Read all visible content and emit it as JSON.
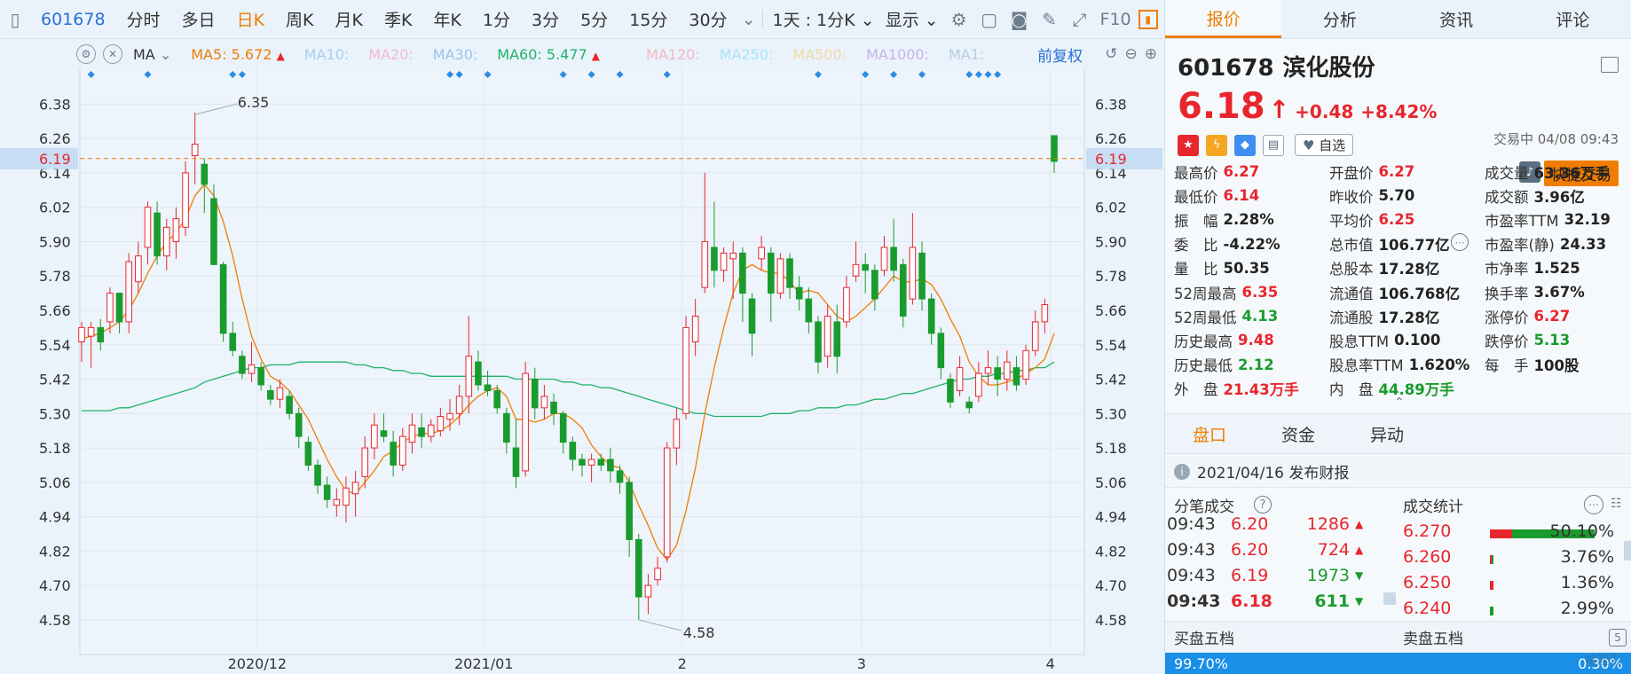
{
  "toolbar": {
    "items": [
      "601678",
      "分时",
      "多日",
      "日K",
      "周K",
      "月K",
      "季K",
      "年K",
      "1分",
      "3分",
      "5分",
      "15分",
      "30分"
    ],
    "more_label": "⌄",
    "timeframe_label": "1天 : 1分K ⌄",
    "display_label": "显示 ⌄",
    "f10_label": "F10"
  },
  "ma_legend": {
    "select_label": "MA",
    "ma5": "MA5: 5.672",
    "ma10": "MA10:",
    "ma20": "MA20:",
    "ma30": "MA30:",
    "ma60": "MA60: 5.477",
    "ma120": "MA120:",
    "ma250": "MA250:",
    "ma500": "MA500:",
    "ma1000": "MA1000:",
    "ma1": "MA1:",
    "fuquan": "前复权"
  },
  "colors": {
    "up": "#e8262d",
    "down": "#1a9b2e",
    "ma5": "#f07d00",
    "ma60": "#1fb36b",
    "accent": "#f07d00",
    "link": "#2a6fd6"
  },
  "right_tabs": [
    "报价",
    "分析",
    "资讯",
    "评论"
  ],
  "stock": {
    "code": "601678",
    "name": "滨化股份",
    "price": "6.18",
    "arrow": "↑",
    "change": "+0.48",
    "change_pct": "+8.42%",
    "status": "交易中 04/08 09:43",
    "zixuan": "自选",
    "fast_trade": "快捷交易"
  },
  "quote": [
    {
      "label": "最高价",
      "value": "6.27",
      "color": "red"
    },
    {
      "label": "开盘价",
      "value": "6.27",
      "color": "red"
    },
    {
      "label": "成交量",
      "value": "63.36万手",
      "color": "dark"
    },
    {
      "label": "最低价",
      "value": "6.14",
      "color": "red"
    },
    {
      "label": "昨收价",
      "value": "5.70",
      "color": "dark"
    },
    {
      "label": "成交额",
      "value": "3.96亿",
      "color": "dark"
    },
    {
      "label": "振　幅",
      "value": "2.28%",
      "color": "dark"
    },
    {
      "label": "平均价",
      "value": "6.25",
      "color": "red"
    },
    {
      "label": "市盈率TTM",
      "value": "32.19",
      "color": "dark"
    },
    {
      "label": "委　比",
      "value": "-4.22%",
      "color": "dark"
    },
    {
      "label": "总市值",
      "value": "106.77亿",
      "color": "dark"
    },
    {
      "label": "市盈率(静)",
      "value": "24.33",
      "color": "dark"
    },
    {
      "label": "量　比",
      "value": "50.35",
      "color": "dark"
    },
    {
      "label": "总股本",
      "value": "17.28亿",
      "color": "dark"
    },
    {
      "label": "市净率",
      "value": "1.525",
      "color": "dark"
    },
    {
      "label": "52周最高",
      "value": "6.35",
      "color": "red"
    },
    {
      "label": "流通值",
      "value": "106.768亿",
      "color": "dark"
    },
    {
      "label": "换手率",
      "value": "3.67%",
      "color": "dark"
    },
    {
      "label": "52周最低",
      "value": "4.13",
      "color": "green"
    },
    {
      "label": "流通股",
      "value": "17.28亿",
      "color": "dark"
    },
    {
      "label": "涨停价",
      "value": "6.27",
      "color": "red"
    },
    {
      "label": "历史最高",
      "value": "9.48",
      "color": "red"
    },
    {
      "label": "股息TTM",
      "value": "0.100",
      "color": "dark"
    },
    {
      "label": "跌停价",
      "value": "5.13",
      "color": "green"
    },
    {
      "label": "历史最低",
      "value": "2.12",
      "color": "green"
    },
    {
      "label": "股息率TTM",
      "value": "1.620%",
      "color": "dark"
    },
    {
      "label": "每　手",
      "value": "100股",
      "color": "dark"
    },
    {
      "label": "外　盘",
      "value": "21.43万手",
      "color": "red"
    },
    {
      "label": "内　盘",
      "value": "44.89万手",
      "color": "green"
    }
  ],
  "sub_tabs": [
    "盘口",
    "资金",
    "异动"
  ],
  "notice": "2021/04/16  发布财报",
  "fenbi": {
    "title": "分笔成交",
    "rows": [
      {
        "time": "09:43",
        "price": "6.20",
        "vol": "1286",
        "dir": "up"
      },
      {
        "time": "09:43",
        "price": "6.20",
        "vol": "724",
        "dir": "up"
      },
      {
        "time": "09:43",
        "price": "6.19",
        "vol": "1973",
        "dir": "down"
      },
      {
        "time": "09:43",
        "price": "6.18",
        "vol": "611",
        "dir": "down"
      }
    ]
  },
  "stats": {
    "title": "成交统计",
    "rows": [
      {
        "price": "6.270",
        "pct": "50.10%",
        "red": 0.21,
        "green": 0.79
      },
      {
        "price": "6.260",
        "pct": "3.76%",
        "red": 0.6,
        "green": 0.4
      },
      {
        "price": "6.250",
        "pct": "1.36%",
        "red": 1.0,
        "green": 0.0
      },
      {
        "price": "6.240",
        "pct": "2.99%",
        "red": 0.0,
        "green": 1.0
      }
    ]
  },
  "book": {
    "buy_title": "买盘五档",
    "sell_title": "卖盘五档",
    "buy_pct": "99.70%",
    "sell_pct": "0.30%"
  },
  "watermark": "格隆汇",
  "chart_data": {
    "type": "candlestick",
    "y_ticks": [
      "6.38",
      "6.26",
      "6.14",
      "6.02",
      "5.90",
      "5.78",
      "5.66",
      "5.54",
      "5.42",
      "5.30",
      "5.18",
      "5.06",
      "4.94",
      "4.82",
      "4.70",
      "4.58"
    ],
    "ylim": [
      4.49,
      6.44
    ],
    "x_labels": [
      "2020/12",
      "2021/01",
      "2",
      "3",
      "4"
    ],
    "current_price_line": "6.19",
    "annotations": {
      "high": "6.35",
      "low": "4.58"
    },
    "candles": [
      [
        5.55,
        5.62,
        5.48,
        5.6
      ],
      [
        5.57,
        5.62,
        5.46,
        5.6
      ],
      [
        5.6,
        5.63,
        5.52,
        5.55
      ],
      [
        5.62,
        5.74,
        5.58,
        5.72
      ],
      [
        5.72,
        5.72,
        5.58,
        5.62
      ],
      [
        5.62,
        5.86,
        5.58,
        5.83
      ],
      [
        5.76,
        5.9,
        5.72,
        5.85
      ],
      [
        5.88,
        6.04,
        5.82,
        6.02
      ],
      [
        6.0,
        6.04,
        5.82,
        5.85
      ],
      [
        5.85,
        5.98,
        5.8,
        5.95
      ],
      [
        5.9,
        6.02,
        5.84,
        5.98
      ],
      [
        5.95,
        6.18,
        5.92,
        6.14
      ],
      [
        6.2,
        6.35,
        6.1,
        6.24
      ],
      [
        6.17,
        6.19,
        6.0,
        6.1
      ],
      [
        6.05,
        6.1,
        5.82,
        5.82
      ],
      [
        5.82,
        5.83,
        5.55,
        5.58
      ],
      [
        5.58,
        5.62,
        5.5,
        5.52
      ],
      [
        5.5,
        5.52,
        5.42,
        5.44
      ],
      [
        5.44,
        5.55,
        5.41,
        5.47
      ],
      [
        5.46,
        5.48,
        5.38,
        5.4
      ],
      [
        5.38,
        5.4,
        5.33,
        5.35
      ],
      [
        5.35,
        5.42,
        5.32,
        5.39
      ],
      [
        5.36,
        5.38,
        5.28,
        5.3
      ],
      [
        5.3,
        5.32,
        5.18,
        5.22
      ],
      [
        5.2,
        5.22,
        5.1,
        5.12
      ],
      [
        5.12,
        5.14,
        5.02,
        5.05
      ],
      [
        5.05,
        5.08,
        4.97,
        5.0
      ],
      [
        4.98,
        5.04,
        4.94,
        5.0
      ],
      [
        4.98,
        5.08,
        4.92,
        5.04
      ],
      [
        5.02,
        5.1,
        4.94,
        5.06
      ],
      [
        5.08,
        5.22,
        5.04,
        5.18
      ],
      [
        5.18,
        5.3,
        5.14,
        5.26
      ],
      [
        5.24,
        5.3,
        5.2,
        5.22
      ],
      [
        5.2,
        5.24,
        5.08,
        5.12
      ],
      [
        5.12,
        5.25,
        5.1,
        5.22
      ],
      [
        5.2,
        5.3,
        5.16,
        5.26
      ],
      [
        5.25,
        5.3,
        5.18,
        5.22
      ],
      [
        5.22,
        5.28,
        5.2,
        5.26
      ],
      [
        5.24,
        5.32,
        5.22,
        5.29
      ],
      [
        5.28,
        5.35,
        5.24,
        5.3
      ],
      [
        5.3,
        5.4,
        5.26,
        5.36
      ],
      [
        5.36,
        5.64,
        5.3,
        5.5
      ],
      [
        5.48,
        5.52,
        5.38,
        5.4
      ],
      [
        5.4,
        5.45,
        5.36,
        5.38
      ],
      [
        5.38,
        5.4,
        5.3,
        5.32
      ],
      [
        5.3,
        5.32,
        5.16,
        5.2
      ],
      [
        5.18,
        5.28,
        5.04,
        5.08
      ],
      [
        5.1,
        5.48,
        5.08,
        5.44
      ],
      [
        5.42,
        5.46,
        5.28,
        5.32
      ],
      [
        5.32,
        5.4,
        5.28,
        5.36
      ],
      [
        5.34,
        5.37,
        5.26,
        5.3
      ],
      [
        5.3,
        5.31,
        5.16,
        5.2
      ],
      [
        5.2,
        5.22,
        5.1,
        5.14
      ],
      [
        5.14,
        5.16,
        5.08,
        5.12
      ],
      [
        5.12,
        5.16,
        5.06,
        5.14
      ],
      [
        5.14,
        5.16,
        5.1,
        5.12
      ],
      [
        5.14,
        5.18,
        5.06,
        5.1
      ],
      [
        5.1,
        5.12,
        5.02,
        5.06
      ],
      [
        5.06,
        5.08,
        4.8,
        4.86
      ],
      [
        4.86,
        4.88,
        4.58,
        4.66
      ],
      [
        4.66,
        4.74,
        4.6,
        4.7
      ],
      [
        4.72,
        4.8,
        4.7,
        4.76
      ],
      [
        4.8,
        5.2,
        4.78,
        5.18
      ],
      [
        5.18,
        5.32,
        5.12,
        5.28
      ],
      [
        5.3,
        5.64,
        5.28,
        5.6
      ],
      [
        5.55,
        5.7,
        5.5,
        5.64
      ],
      [
        5.74,
        6.14,
        5.72,
        5.9
      ],
      [
        5.88,
        6.04,
        5.74,
        5.8
      ],
      [
        5.8,
        5.88,
        5.76,
        5.86
      ],
      [
        5.84,
        5.9,
        5.7,
        5.86
      ],
      [
        5.86,
        5.88,
        5.62,
        5.72
      ],
      [
        5.7,
        5.72,
        5.5,
        5.58
      ],
      [
        5.84,
        5.92,
        5.8,
        5.88
      ],
      [
        5.86,
        5.88,
        5.62,
        5.72
      ],
      [
        5.72,
        5.86,
        5.7,
        5.84
      ],
      [
        5.84,
        5.86,
        5.7,
        5.74
      ],
      [
        5.74,
        5.78,
        5.66,
        5.7
      ],
      [
        5.7,
        5.74,
        5.58,
        5.62
      ],
      [
        5.62,
        5.64,
        5.44,
        5.48
      ],
      [
        5.5,
        5.68,
        5.46,
        5.64
      ],
      [
        5.62,
        5.68,
        5.44,
        5.5
      ],
      [
        5.62,
        5.78,
        5.6,
        5.74
      ],
      [
        5.78,
        5.9,
        5.76,
        5.82
      ],
      [
        5.82,
        5.86,
        5.72,
        5.8
      ],
      [
        5.8,
        5.82,
        5.66,
        5.7
      ],
      [
        5.8,
        5.92,
        5.78,
        5.88
      ],
      [
        5.88,
        5.98,
        5.76,
        5.8
      ],
      [
        5.82,
        5.84,
        5.6,
        5.64
      ],
      [
        5.7,
        6.0,
        5.68,
        5.88
      ],
      [
        5.86,
        5.9,
        5.66,
        5.7
      ],
      [
        5.7,
        5.72,
        5.54,
        5.58
      ],
      [
        5.58,
        5.6,
        5.42,
        5.46
      ],
      [
        5.42,
        5.44,
        5.32,
        5.34
      ],
      [
        5.38,
        5.5,
        5.36,
        5.46
      ],
      [
        5.34,
        5.36,
        5.3,
        5.32
      ],
      [
        5.36,
        5.48,
        5.34,
        5.44
      ],
      [
        5.44,
        5.52,
        5.4,
        5.46
      ],
      [
        5.46,
        5.5,
        5.36,
        5.42
      ],
      [
        5.42,
        5.52,
        5.38,
        5.48
      ],
      [
        5.46,
        5.5,
        5.38,
        5.4
      ],
      [
        5.42,
        5.54,
        5.4,
        5.52
      ],
      [
        5.52,
        5.66,
        5.5,
        5.62
      ],
      [
        5.62,
        5.7,
        5.58,
        5.68
      ],
      [
        6.27,
        6.27,
        6.14,
        6.18
      ]
    ],
    "ma5": [
      5.56,
      5.57,
      5.58,
      5.6,
      5.62,
      5.66,
      5.72,
      5.79,
      5.85,
      5.9,
      5.93,
      5.98,
      6.06,
      6.1,
      6.06,
      5.97,
      5.85,
      5.7,
      5.57,
      5.49,
      5.43,
      5.41,
      5.38,
      5.33,
      5.28,
      5.21,
      5.14,
      5.08,
      5.03,
      5.02,
      5.06,
      5.1,
      5.15,
      5.17,
      5.2,
      5.22,
      5.23,
      5.23,
      5.24,
      5.26,
      5.29,
      5.33,
      5.36,
      5.38,
      5.39,
      5.36,
      5.28,
      5.28,
      5.27,
      5.28,
      5.3,
      5.3,
      5.28,
      5.25,
      5.19,
      5.15,
      5.12,
      5.11,
      5.06,
      4.98,
      4.91,
      4.83,
      4.79,
      4.84,
      4.96,
      5.11,
      5.3,
      5.46,
      5.6,
      5.72,
      5.8,
      5.82,
      5.8,
      5.79,
      5.79,
      5.76,
      5.72,
      5.73,
      5.72,
      5.68,
      5.64,
      5.62,
      5.64,
      5.67,
      5.7,
      5.74,
      5.78,
      5.76,
      5.76,
      5.77,
      5.75,
      5.7,
      5.63,
      5.57,
      5.48,
      5.43,
      5.4,
      5.4,
      5.41,
      5.42,
      5.44,
      5.46,
      5.49,
      5.58
    ],
    "ma60": [
      5.31,
      5.31,
      5.31,
      5.31,
      5.32,
      5.32,
      5.33,
      5.34,
      5.35,
      5.36,
      5.37,
      5.38,
      5.39,
      5.41,
      5.42,
      5.43,
      5.44,
      5.45,
      5.46,
      5.46,
      5.47,
      5.47,
      5.47,
      5.48,
      5.48,
      5.48,
      5.48,
      5.48,
      5.48,
      5.47,
      5.47,
      5.46,
      5.46,
      5.45,
      5.45,
      5.44,
      5.44,
      5.43,
      5.43,
      5.43,
      5.43,
      5.43,
      5.43,
      5.43,
      5.43,
      5.43,
      5.42,
      5.42,
      5.42,
      5.42,
      5.42,
      5.41,
      5.41,
      5.4,
      5.4,
      5.39,
      5.39,
      5.38,
      5.37,
      5.36,
      5.35,
      5.34,
      5.33,
      5.32,
      5.31,
      5.3,
      5.3,
      5.29,
      5.29,
      5.29,
      5.29,
      5.29,
      5.29,
      5.3,
      5.3,
      5.3,
      5.31,
      5.31,
      5.32,
      5.32,
      5.32,
      5.33,
      5.33,
      5.34,
      5.35,
      5.35,
      5.36,
      5.37,
      5.37,
      5.38,
      5.39,
      5.4,
      5.41,
      5.42,
      5.42,
      5.43,
      5.43,
      5.44,
      5.44,
      5.45,
      5.45,
      5.46,
      5.46,
      5.48
    ]
  }
}
